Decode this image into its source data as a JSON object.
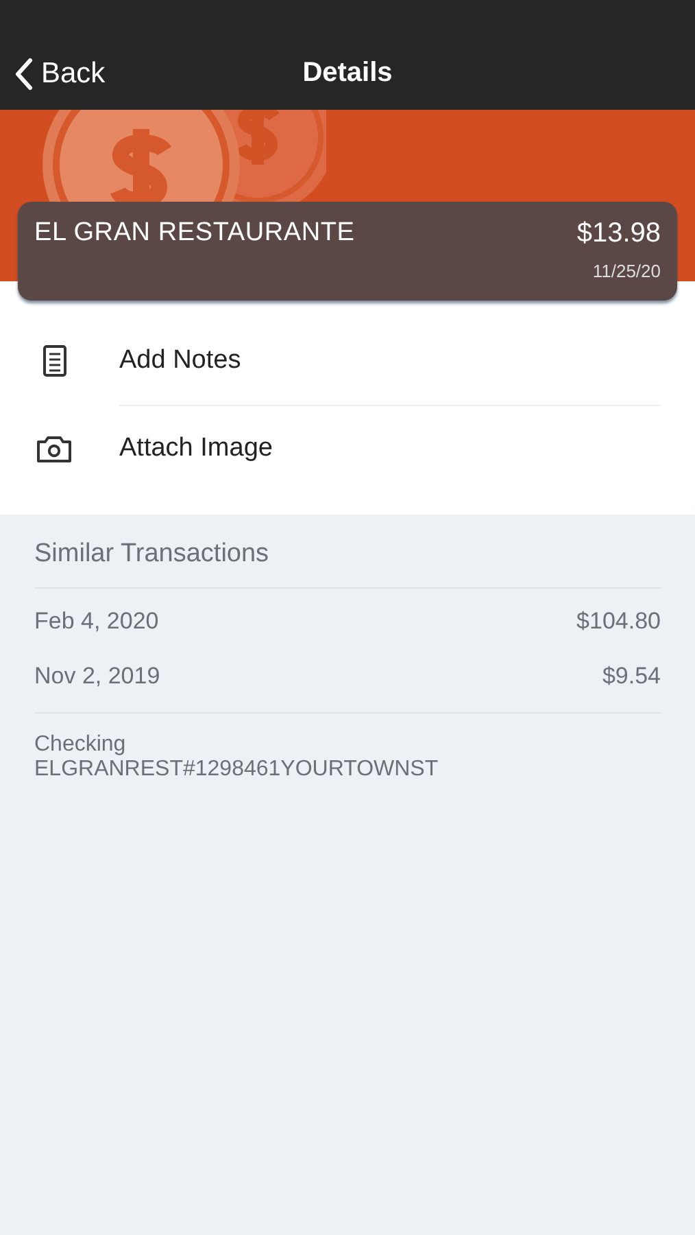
{
  "nav": {
    "back": "Back",
    "title": "Details"
  },
  "transaction": {
    "merchant": "EL GRAN RESTAURANTE",
    "amount": "$13.98",
    "date": "11/25/20"
  },
  "actions": [
    {
      "kind": "notes",
      "label": "Add Notes"
    },
    {
      "kind": "camera",
      "label": "Attach Image"
    }
  ],
  "similar": {
    "title": "Similar Transactions",
    "rows": [
      {
        "date": "Feb 4, 2020",
        "amount": "$104.80"
      },
      {
        "date": "Nov 2, 2019",
        "amount": "$9.54"
      }
    ]
  },
  "account": {
    "name": "Checking",
    "description": "ELGRANREST#1298461YOURTOWNST"
  }
}
